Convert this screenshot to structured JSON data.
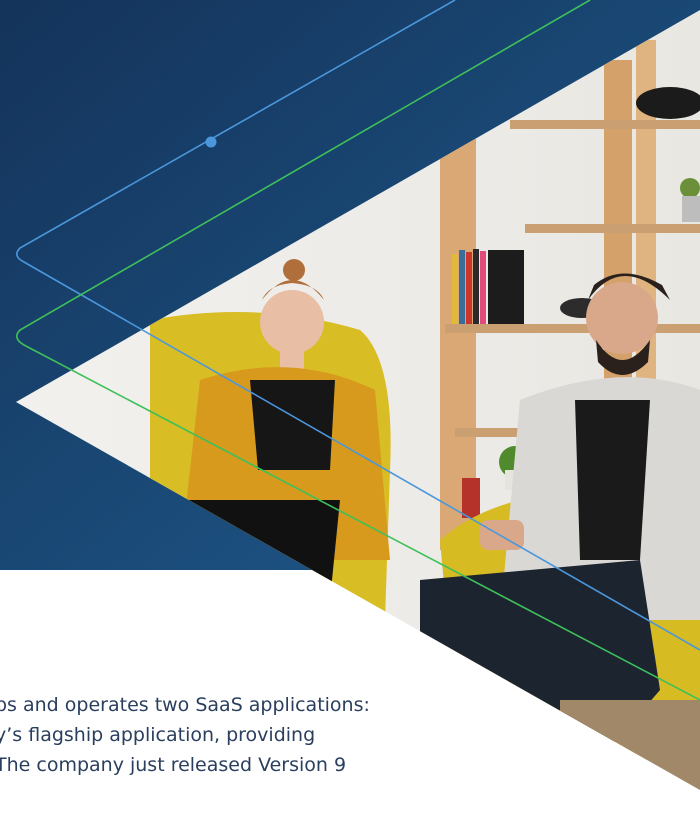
{
  "text_lines": [
    "ps and operates two SaaS applications:",
    "y’s flagship application, providing",
    "The company just released Version 9"
  ],
  "colors": {
    "navy_dark": "#17365b",
    "navy_light": "#1f5c8f",
    "line_blue": "#3f8fd4",
    "line_green": "#3fbf5a",
    "text": "#2a3f5e"
  }
}
